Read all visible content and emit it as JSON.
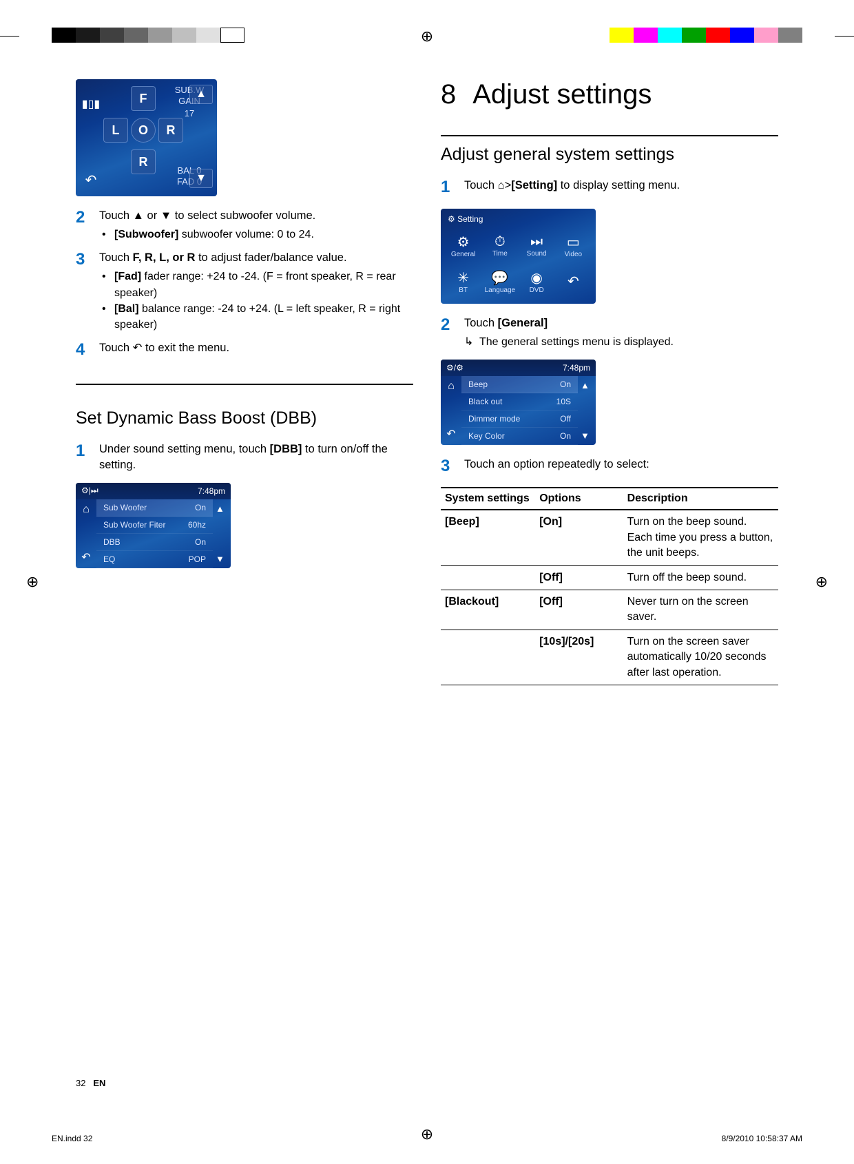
{
  "printer_marks": {
    "left_bar_colors": [
      "#000",
      "#1a1a1a",
      "#404040",
      "#666",
      "#999",
      "#bfbfbf",
      "#e0e0e0",
      "#fff"
    ],
    "right_bar_colors": [
      "#ffff00",
      "#ff00ff",
      "#00ffff",
      "#00a000",
      "#ff0000",
      "#0000ff",
      "#ff9ecb",
      "#808080"
    ]
  },
  "left": {
    "fader_shot": {
      "labels": {
        "F": "F",
        "L": "L",
        "O": "O",
        "R1": "R",
        "R2": "R"
      },
      "subw_label": "SUB.W",
      "gain_label": "GAIN",
      "gain_value": "17",
      "bal_label": "BAL 0",
      "fad_label": "FAD 0"
    },
    "step2": {
      "text_pre": "Touch ",
      "text_mid": " or ",
      "text_post": " to select subwoofer volume.",
      "bullet_label": "[Subwoofer]",
      "bullet_text": " subwoofer volume: 0 to 24."
    },
    "step3": {
      "text_pre": "Touch ",
      "keys": "F, R, L, or R",
      "text_post": " to adjust fader/balance value.",
      "b1_label": "[Fad]",
      "b1_text": " fader range: +24 to -24. (F = front speaker, R = rear speaker)",
      "b2_label": "[Bal]",
      "b2_text": " balance range: -24 to +24. (L = left speaker, R = right speaker)"
    },
    "step4": {
      "text_pre": "Touch ",
      "text_post": " to exit the menu."
    },
    "dbb_heading": "Set Dynamic Bass Boost (DBB)",
    "dbb_step1": {
      "text_pre": "Under sound setting menu, touch ",
      "label": "[DBB]",
      "text_post": " to turn on/off the setting."
    },
    "sound_shot": {
      "hdr_left": "⚙|⏭",
      "hdr_right": "7:48pm",
      "rows": [
        {
          "name": "Sub Woofer",
          "val": "On",
          "sel": true
        },
        {
          "name": "Sub Woofer Fiter",
          "val": "60hz",
          "sel": false
        },
        {
          "name": "DBB",
          "val": "On",
          "sel": false
        },
        {
          "name": "EQ",
          "val": "POP",
          "sel": false
        }
      ]
    }
  },
  "right": {
    "chapter_num": "8",
    "chapter_title": "Adjust settings",
    "section": "Adjust general system settings",
    "step1": {
      "text_pre": "Touch ",
      "text_mid": ">",
      "label": "[Setting]",
      "text_post": " to display setting menu."
    },
    "setting_shot": {
      "hdr": "⚙ Setting",
      "tiles": [
        {
          "icon": "⚙",
          "label": "General"
        },
        {
          "icon": "⏱",
          "label": "Time"
        },
        {
          "icon": "⏭",
          "label": "Sound"
        },
        {
          "icon": "▭",
          "label": "Video"
        },
        {
          "icon": "✳",
          "label": "BT"
        },
        {
          "icon": "💬",
          "label": "Language"
        },
        {
          "icon": "◉",
          "label": "DVD"
        },
        {
          "icon": "↶",
          "label": ""
        }
      ]
    },
    "step2": {
      "text_pre": "Touch ",
      "label": "[General]",
      "bullet": "The general settings menu is displayed."
    },
    "general_shot": {
      "hdr_left": "⚙/⚙",
      "hdr_right": "7:48pm",
      "rows": [
        {
          "name": "Beep",
          "val": "On",
          "sel": true
        },
        {
          "name": "Black out",
          "val": "10S",
          "sel": false
        },
        {
          "name": "Dimmer mode",
          "val": "Off",
          "sel": false
        },
        {
          "name": "Key Color",
          "val": "On",
          "sel": false
        }
      ]
    },
    "step3": "Touch an option repeatedly to select:",
    "table": {
      "h1": "System settings",
      "h2": "Options",
      "h3": "Description",
      "rows": [
        {
          "s": "[Beep]",
          "o": "[On]",
          "d": "Turn on the beep sound. Each time you press a button, the unit beeps."
        },
        {
          "s": "",
          "o": "[Off]",
          "d": "Turn off the beep sound."
        },
        {
          "s": "[Blackout]",
          "o": "[Off]",
          "d": "Never turn on the screen saver."
        },
        {
          "s": "",
          "o": "[10s]/[20s]",
          "d": "Turn on the screen saver automatically 10/20 seconds after last operation."
        }
      ]
    }
  },
  "footer": {
    "page": "32",
    "lang": "EN"
  },
  "slug": {
    "file": "EN.indd   32",
    "date": "8/9/2010   10:58:37 AM"
  }
}
